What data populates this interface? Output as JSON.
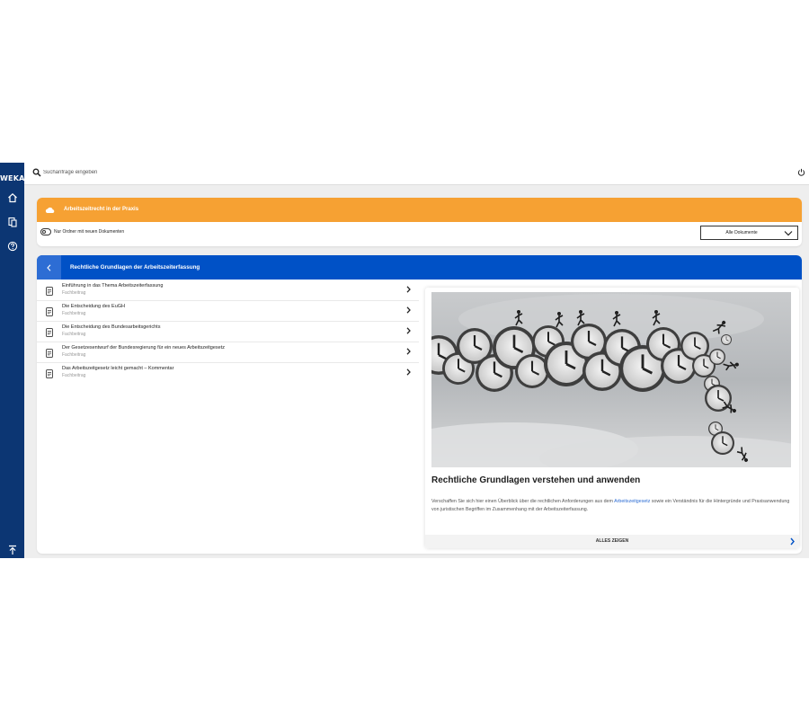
{
  "brand": {
    "logo": "WEKA"
  },
  "colors": {
    "sidebar": "#0c3673",
    "orange": "#f6a133",
    "blue": "#0051c6",
    "link": "#2d6dd4"
  },
  "search": {
    "placeholder": "Suchanfrage eingeben",
    "value": ""
  },
  "sidebar": {
    "items": [
      {
        "icon": "home-icon"
      },
      {
        "icon": "documents-icon"
      },
      {
        "icon": "help-icon"
      },
      {
        "icon": "scroll-top-icon"
      }
    ]
  },
  "topbar": {
    "power_icon": "power-icon"
  },
  "folder": {
    "title": "Arbeitszeitrecht in der Praxis",
    "toggle_label": "Nur Ordner mit neuen Dokumenten",
    "toggle_on": false,
    "filter_selected": "Alle Dokumente"
  },
  "section": {
    "title": "Rechtliche Grundlagen der Arbeitszeiterfassung",
    "items": [
      {
        "title": "Einführung in das Thema Arbeitszeiterfassung",
        "type": "Fachbeitrag"
      },
      {
        "title": "Die Entscheidung des EuGH",
        "type": "Fachbeitrag"
      },
      {
        "title": "Die Entscheidung des Bundesarbeitsgerichts",
        "type": "Fachbeitrag"
      },
      {
        "title": "Der Gesetzesentwurf der Bundesregierung für ein neues Arbeitszeitgesetz",
        "type": "Fachbeitrag"
      },
      {
        "title": "Das Arbeitszeitgesetz leicht gemacht – Kommentar",
        "type": "Fachbeitrag"
      }
    ]
  },
  "card": {
    "title": "Rechtliche Grundlagen verstehen und anwenden",
    "text_before": "Verschaffen Sie sich hier einen Überblick über die rechtlichen Anforderungen aus dem ",
    "link": "Arbeitszeitgesetz",
    "text_after": " sowie ein Verständnis für die Hintergründe und Praxisanwendung von juristischen Begriffen im Zusammenhang mit der Arbeitszeiterfassung.",
    "footer": "ALLES ZEIGEN"
  }
}
